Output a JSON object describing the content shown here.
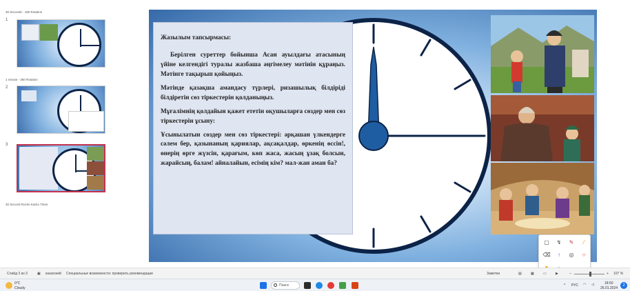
{
  "thumbnails": {
    "sections": [
      {
        "title": "30 Seconds - 180 Rotation",
        "slide_number": "1"
      },
      {
        "title": "1 minute - 360 Rotation",
        "slide_number": "2"
      },
      {
        "title": "",
        "slide_number": "3"
      },
      {
        "title": "30 Second Rocks Kacko Timer",
        "slide_number": ""
      }
    ]
  },
  "slide": {
    "heading": "Жазылым тапсырмасы:",
    "paragraphs": [
      "Берілген суреттер бойынша Асан ауылдағы атасының үйіне келгендігі туралы жазбаша әңгімелеу мәтінін құраңыз. Мәтінге тақырып қойыңыз.",
      "Мәтінде қазақша амандасу түрлері, ризашылық білдіріді білдіретін сөз тіркестерін қолданыңыз.",
      "Мұғалімнің қолдайын қажет ететін оқушыларға сөздер мен сөз тіркестерін ұсыну:",
      "Ұсынылатын сөздер мен сөз тіркестері: әрқашан үлкендерге сәлем бер, қазынаның қариялар, ақсақалдар, өркенің өссін!, өнерің өрге жүзсін, қарағым, көп жаса, жасың ұзақ болсын, жарайсың, балам! айналайын, есімің кім? мал-жан аман ба?"
    ]
  },
  "statusbar": {
    "slide_info": "Слайд 3 из 3",
    "language": "казахский",
    "accessibility": "Специальные возможности: проверить рекомендации",
    "notes": "Заметки",
    "zoom": "107 %"
  },
  "taskbar": {
    "weather_temp": "0°C",
    "weather_desc": "Cloudy",
    "search_placeholder": "Поиск",
    "lang": "РУС",
    "time": "18:50",
    "date": "26.01.2024",
    "notification_count": "2"
  },
  "colors": {
    "clock_rim": "#0c2347",
    "clock_hub": "#1f5da3",
    "selected_border": "#c4314b",
    "slide_bg": "#3569a8"
  }
}
